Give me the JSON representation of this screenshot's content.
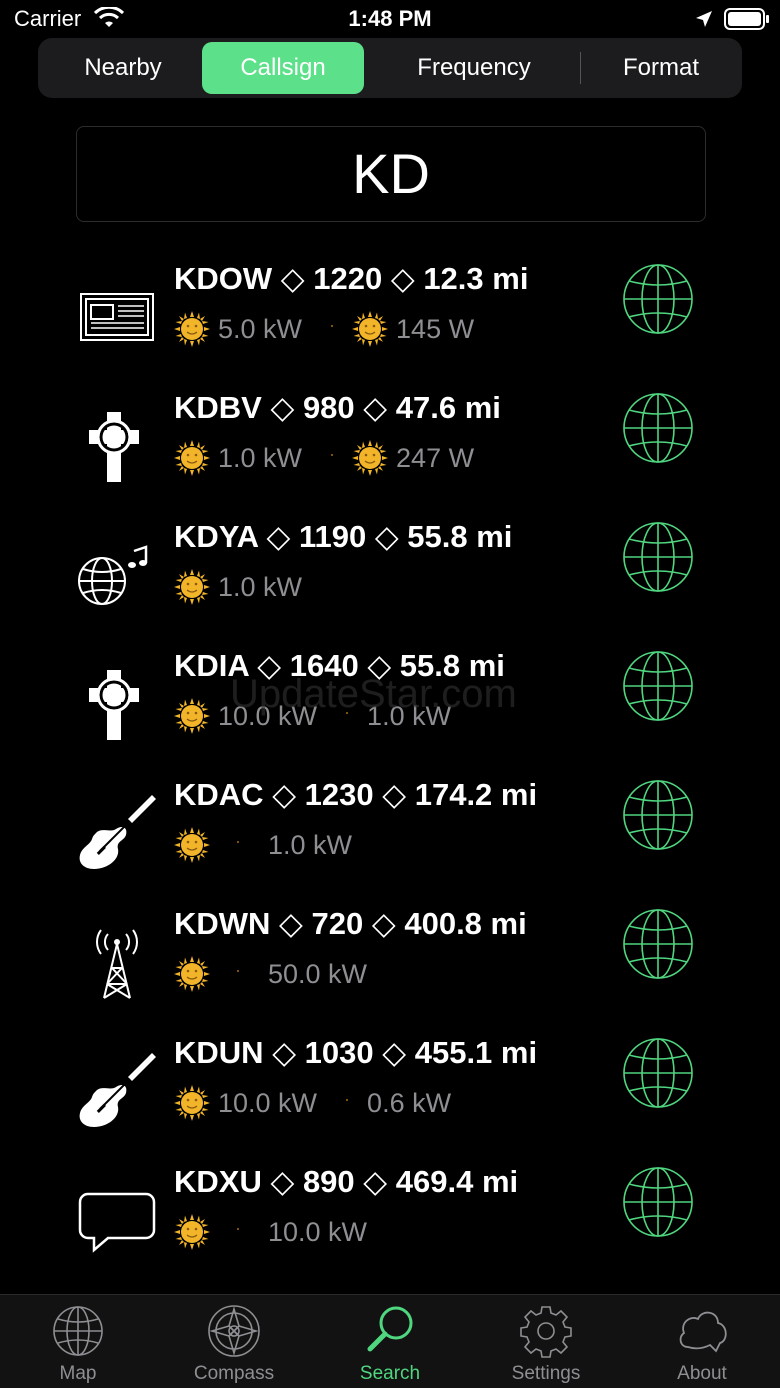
{
  "status_bar": {
    "carrier": "Carrier",
    "time": "1:48 PM"
  },
  "segments": [
    {
      "label": "Nearby",
      "active": false
    },
    {
      "label": "Callsign",
      "active": true
    },
    {
      "label": "Frequency",
      "active": false
    },
    {
      "label": "Format",
      "active": false
    }
  ],
  "search": {
    "value": "KD"
  },
  "stations": [
    {
      "callsign": "KDOW",
      "freq": "1220",
      "distance": "12.3 mi",
      "format_icon": "news-icon",
      "day_power": "5.0 kW",
      "night_power": "145 W",
      "night_sun": true,
      "day_sun": true
    },
    {
      "callsign": "KDBV",
      "freq": "980",
      "distance": "47.6 mi",
      "format_icon": "religious-cross-icon",
      "day_power": "1.0 kW",
      "night_power": "247 W",
      "night_sun": true,
      "day_sun": true
    },
    {
      "callsign": "KDYA",
      "freq": "1190",
      "distance": "55.8 mi",
      "format_icon": "world-music-icon",
      "day_power": "1.0 kW"
    },
    {
      "callsign": "KDIA",
      "freq": "1640",
      "distance": "55.8 mi",
      "format_icon": "religious-cross-icon",
      "day_power": "10.0 kW",
      "night_power": "1.0 kW"
    },
    {
      "callsign": "KDAC",
      "freq": "1230",
      "distance": "174.2 mi",
      "format_icon": "guitar-icon",
      "combined_power": "1.0 kW"
    },
    {
      "callsign": "KDWN",
      "freq": "720",
      "distance": "400.8 mi",
      "format_icon": "radio-tower-icon",
      "combined_power": "50.0 kW"
    },
    {
      "callsign": "KDUN",
      "freq": "1030",
      "distance": "455.1 mi",
      "format_icon": "guitar-icon",
      "day_power": "10.0 kW",
      "night_power": "0.6 kW"
    },
    {
      "callsign": "KDXU",
      "freq": "890",
      "distance": "469.4 mi",
      "format_icon": "talk-bubble-icon",
      "combined_power": "10.0 kW"
    }
  ],
  "separator": "◇",
  "watermark": "UpdateStar.com",
  "tabs": [
    {
      "label": "Map",
      "icon": "globe-icon",
      "active": false
    },
    {
      "label": "Compass",
      "icon": "compass-icon",
      "active": false
    },
    {
      "label": "Search",
      "icon": "magnifier-icon",
      "active": true
    },
    {
      "label": "Settings",
      "icon": "gear-icon",
      "active": false
    },
    {
      "label": "About",
      "icon": "cloud-icon",
      "active": false
    }
  ],
  "colors": {
    "accent": "#5ce08a",
    "globe": "#4fd67f",
    "sun": "#f2b52a",
    "moon": "#f2c23a",
    "secondary": "#8e8e93"
  }
}
